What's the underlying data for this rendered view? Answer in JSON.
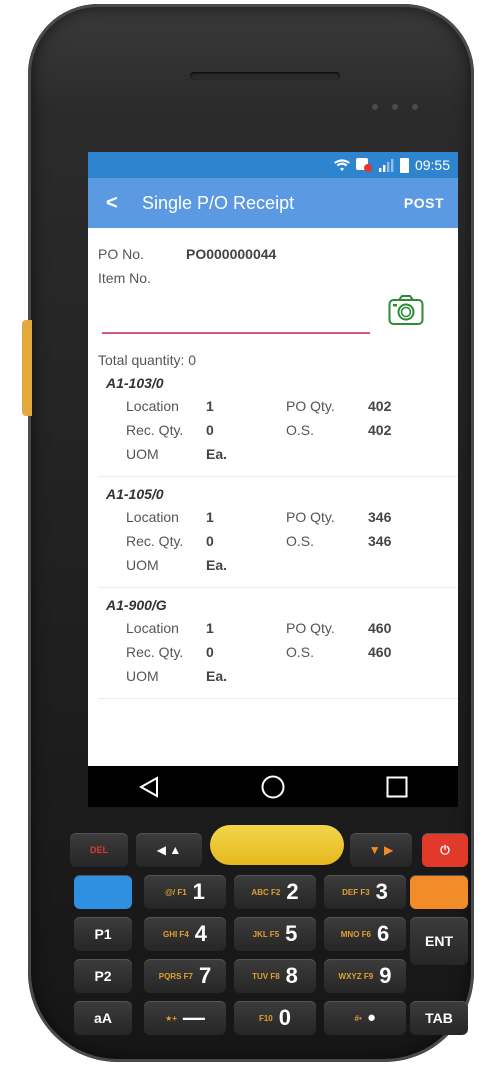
{
  "status_bar": {
    "time": "09:55",
    "icons": [
      "wifi-icon",
      "notification-icon",
      "signal-icon",
      "battery-icon"
    ]
  },
  "app_bar": {
    "back_label": "<",
    "title": "Single P/O Receipt",
    "post_label": "POST"
  },
  "form": {
    "po_label": "PO No.",
    "po_value": "PO000000044",
    "item_label": "Item No.",
    "item_value": "",
    "total_label": "Total quantity: 0"
  },
  "records": [
    {
      "title": "A1-103/0",
      "location_label": "Location",
      "location": "1",
      "po_qty_label": "PO Qty.",
      "po_qty": "402",
      "rec_qty_label": "Rec. Qty.",
      "rec_qty": "0",
      "os_label": "O.S.",
      "os": "402",
      "uom_label": "UOM",
      "uom": "Ea."
    },
    {
      "title": "A1-105/0",
      "location_label": "Location",
      "location": "1",
      "po_qty_label": "PO Qty.",
      "po_qty": "346",
      "rec_qty_label": "Rec. Qty.",
      "rec_qty": "0",
      "os_label": "O.S.",
      "os": "346",
      "uom_label": "UOM",
      "uom": "Ea."
    },
    {
      "title": "A1-900/G",
      "location_label": "Location",
      "location": "1",
      "po_qty_label": "PO Qty.",
      "po_qty": "460",
      "rec_qty_label": "Rec. Qty.",
      "rec_qty": "0",
      "os_label": "O.S.",
      "os": "460",
      "uom_label": "UOM",
      "uom": "Ea."
    }
  ],
  "keypad": {
    "row1": [
      "DEL",
      "◀ ▲",
      "▼ ▶"
    ],
    "keys": [
      {
        "sub": "@/ F1",
        "num": "1"
      },
      {
        "sub": "ABC F2",
        "num": "2"
      },
      {
        "sub": "DEF F3",
        "num": "3"
      },
      {
        "sub": "GHI F4",
        "num": "4"
      },
      {
        "sub": "JKL F5",
        "num": "5"
      },
      {
        "sub": "MNO F6",
        "num": "6"
      },
      {
        "sub": "PQRS F7",
        "num": "7"
      },
      {
        "sub": "TUV F8",
        "num": "8"
      },
      {
        "sub": "WXYZ F9",
        "num": "9"
      },
      {
        "sub": "★+",
        "num": "—"
      },
      {
        "sub": "F10",
        "num": "0"
      },
      {
        "sub": "#•",
        "num": "•"
      }
    ],
    "p1": "P1",
    "p2": "P2",
    "aa": "aA",
    "ent": "ENT",
    "tab": "TAB"
  },
  "colors": {
    "status_bar": "#2e84cf",
    "app_bar": "#5b9ae2",
    "input_underline": "#cf5c7d",
    "camera": "#2e8b3a",
    "blue_key": "#2f8fe0",
    "orange_key": "#f28c28",
    "red_key": "#e23a2a",
    "scan_key": "#f0c830"
  }
}
